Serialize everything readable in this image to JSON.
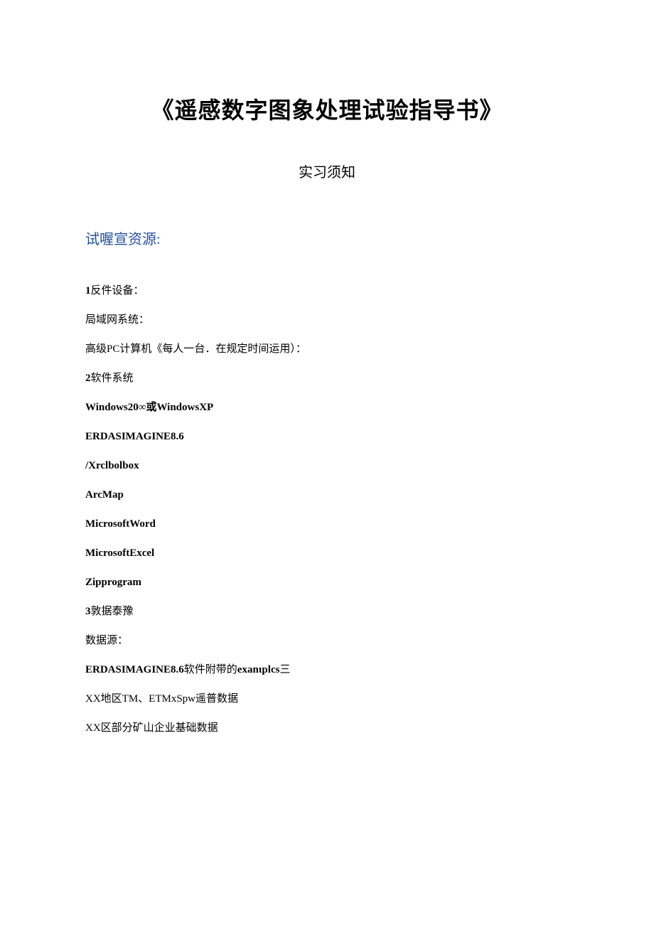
{
  "title": "《遥感数字图象处理试验指导书》",
  "subtitle": "实习须知",
  "section_header": "试喔宣资源:",
  "lines": [
    {
      "prefix": "1",
      "suffix": "反件设备：",
      "bold": true,
      "mixed": true
    },
    {
      "text": "局域网系统：",
      "bold": false
    },
    {
      "text": "高级PC计算机《每人一台．在规定时间运用）：",
      "bold": false
    },
    {
      "prefix": "2",
      "suffix": "软件系统",
      "bold": true,
      "mixed": true
    },
    {
      "text": "Windows20∞或WindowsXP",
      "bold": true
    },
    {
      "text": "ERDASIMAGINE8.6",
      "bold": true
    },
    {
      "text": "/Xrclbolbox",
      "bold": true
    },
    {
      "text": "ArcMap",
      "bold": true
    },
    {
      "text": "MicrosoftWord",
      "bold": true
    },
    {
      "text": "MicrosoftExcel",
      "bold": true
    },
    {
      "text": "Zipprogram",
      "bold": true
    },
    {
      "prefix": "3",
      "suffix": "敦据泰豫",
      "bold": true,
      "mixed": true
    },
    {
      "text": "数据源：",
      "bold": false
    },
    {
      "prefix_bold": "ERDASIMAGINE8.6",
      "mid": "软件附带的",
      "suffix_bold": "exanιplcs",
      "tail": "三",
      "bold": false,
      "complex": true
    },
    {
      "text": "XX地区TM、ETMxSpw遥普数据",
      "bold": false
    },
    {
      "text": "XX区部分矿山企业基础数据",
      "bold": false
    }
  ]
}
